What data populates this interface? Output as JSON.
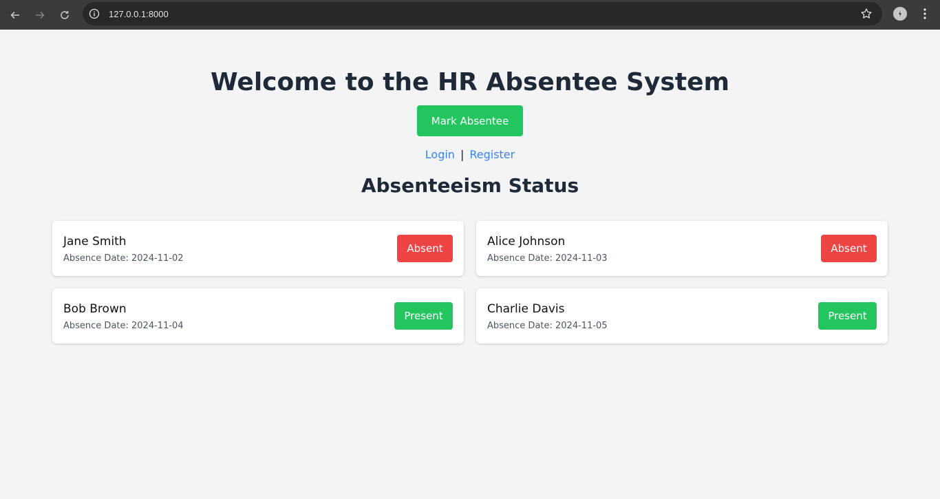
{
  "browser": {
    "url": "127.0.0.1:8000",
    "icons": {
      "back": "arrow-left-icon",
      "forward": "arrow-right-icon",
      "reload": "reload-icon",
      "info": "info-icon",
      "bookmark": "star-icon",
      "extension": "extension-icon",
      "menu": "kebab-menu-icon"
    }
  },
  "page": {
    "title": "Welcome to the HR Absentee System",
    "mark_button": "Mark Absentee",
    "login_link": "Login",
    "separator": "|",
    "register_link": "Register",
    "section_title": "Absenteeism Status"
  },
  "employees": [
    {
      "name": "Jane Smith",
      "date_label": "Absence Date: 2024-11-02",
      "status": "Absent"
    },
    {
      "name": "Alice Johnson",
      "date_label": "Absence Date: 2024-11-03",
      "status": "Absent"
    },
    {
      "name": "Bob Brown",
      "date_label": "Absence Date: 2024-11-04",
      "status": "Present"
    },
    {
      "name": "Charlie Davis",
      "date_label": "Absence Date: 2024-11-05",
      "status": "Present"
    }
  ],
  "colors": {
    "present": "#22c55e",
    "absent": "#ef4444",
    "link": "#3b82f6",
    "heading": "#1f2937",
    "background": "#f3f4f6"
  }
}
